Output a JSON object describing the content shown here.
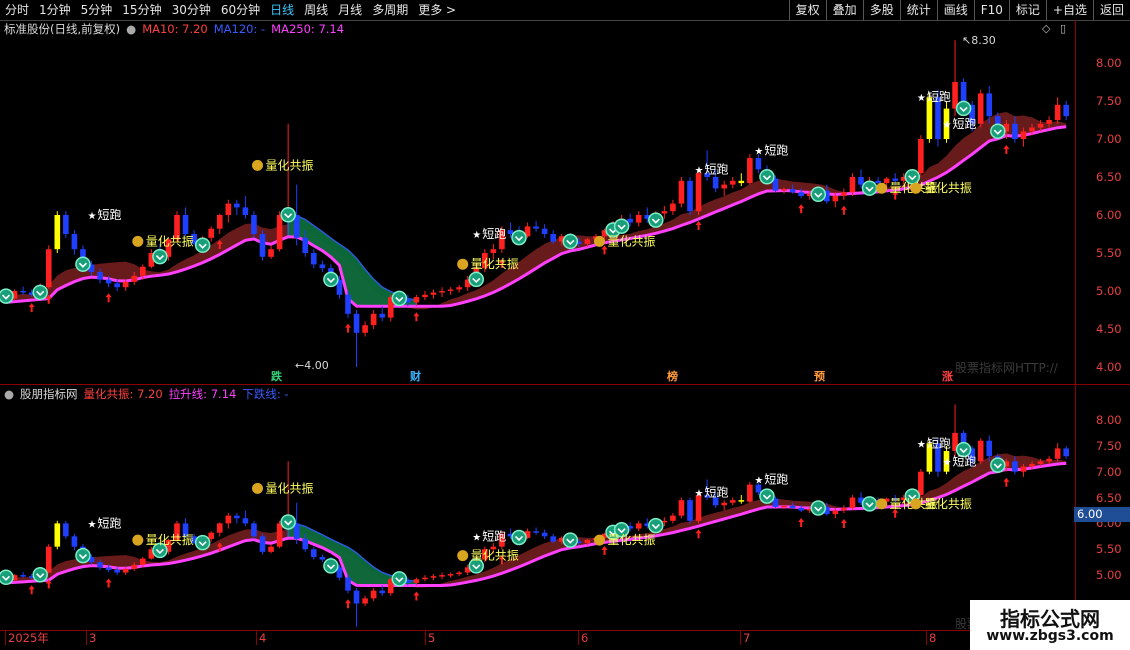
{
  "toolbar": {
    "periods": [
      "分时",
      "1分钟",
      "5分钟",
      "15分钟",
      "30分钟",
      "60分钟",
      "日线",
      "周线",
      "月线",
      "多周期",
      "更多 >"
    ],
    "active_period": "日线",
    "right_buttons": [
      "复权",
      "叠加",
      "多股",
      "统计",
      "画线",
      "F10",
      "标记",
      "+自选",
      "返回"
    ]
  },
  "main_legend": {
    "title": "标准股份(日线,前复权)",
    "ma10": "MA10: 7.20",
    "ma120": "MA120: -",
    "ma250": "MA250: 7.14"
  },
  "sub_legend": {
    "title": "股朋指标网",
    "resonance": "量化共振: 7.20",
    "rise_line": "拉升线: 7.14",
    "fall_line": "下跌线: -"
  },
  "axis_main": [
    "8.00",
    "7.50",
    "7.00",
    "6.50",
    "6.00",
    "5.50",
    "5.00",
    "4.50",
    "4.00"
  ],
  "axis_sub": [
    "8.00",
    "7.50",
    "7.00",
    "6.50",
    "6.00",
    "5.50",
    "5.00"
  ],
  "current_price": "6.00",
  "max_label": "8.30",
  "min_label": "4.00",
  "labels": {
    "short_run": "短跑",
    "resonance": "量化共振"
  },
  "events": [
    {
      "text": "跌",
      "color": "#37d37a"
    },
    {
      "text": "财",
      "color": "#39b6ff"
    },
    {
      "text": "榜",
      "color": "#ff9a3c"
    },
    {
      "text": "预",
      "color": "#ff9a3c"
    },
    {
      "text": "涨",
      "color": "#ff4040"
    }
  ],
  "dates": [
    "2025年",
    "3",
    "4",
    "5",
    "6",
    "7",
    "8"
  ],
  "watermark": "股票指标网HTTP://",
  "watermark2": "股票指",
  "brand": {
    "line1": "指标公式网",
    "line2": "www.zbgs3.com"
  },
  "colors": {
    "up": "#ff2020",
    "down": "#2040ff",
    "ma": "#ff40ff",
    "gold": "#ffff00"
  }
}
